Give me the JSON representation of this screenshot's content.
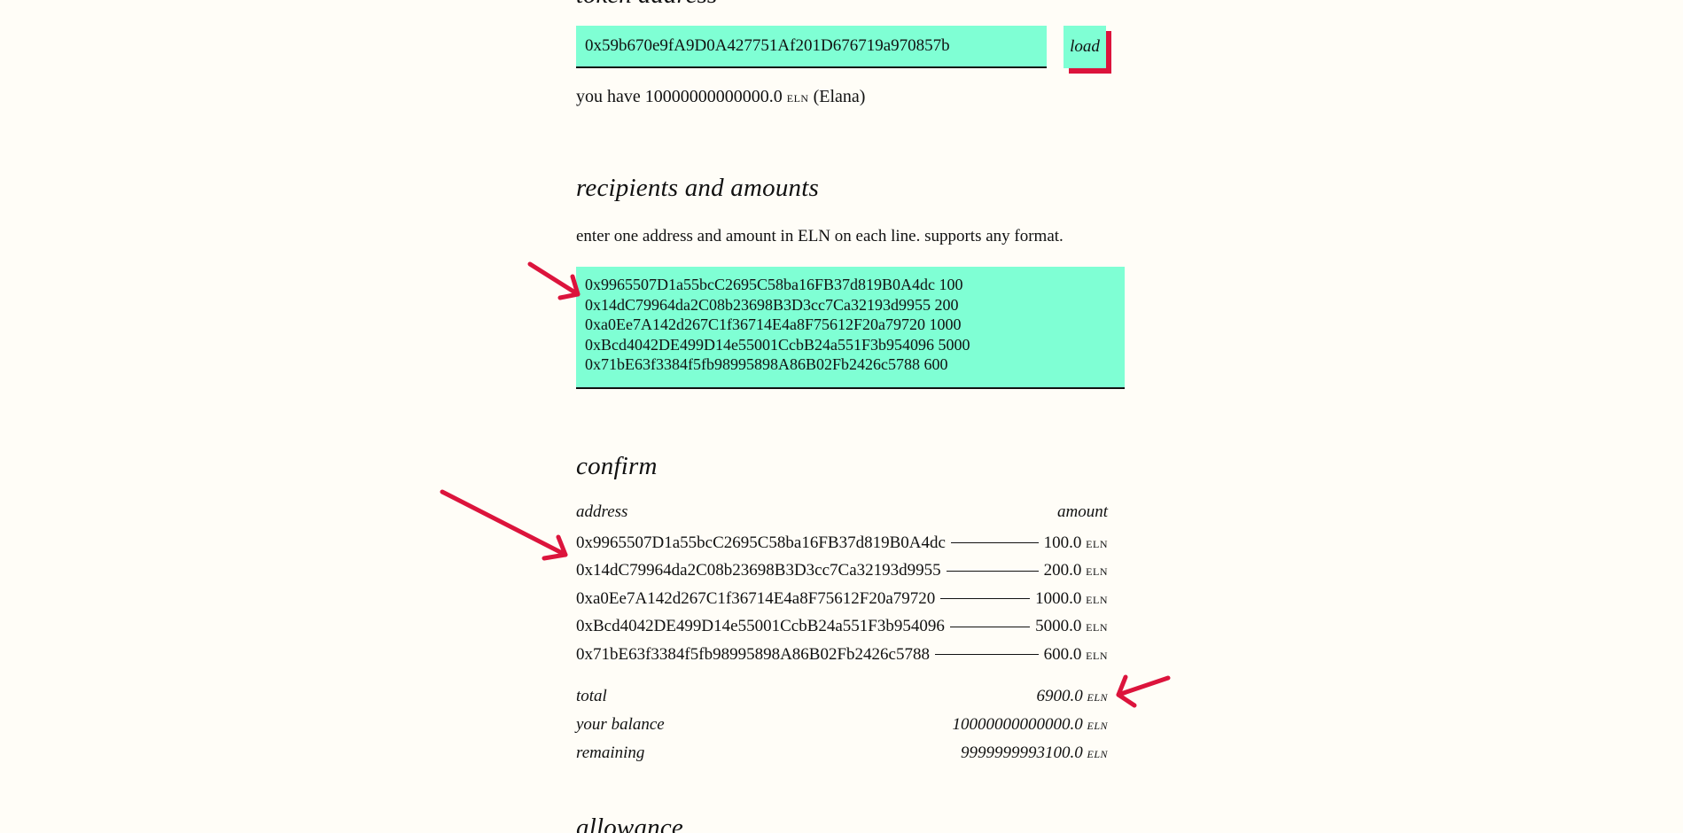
{
  "token": {
    "heading": "token address",
    "address_value": "0x59b670e9fA9D0A427751Af201D676719a970857b",
    "load_label": "load",
    "balance_prefix": "you have 10000000000000.0",
    "balance_unit": "eln",
    "balance_name": "(Elana)"
  },
  "recipients": {
    "heading": "recipients and amounts",
    "help": "enter one address and amount in ELN on each line. supports any format.",
    "textarea_value": "0x9965507D1a55bcC2695C58ba16FB37d819B0A4dc 100\n0x14dC79964da2C08b23698B3D3cc7Ca32193d9955 200\n0xa0Ee7A142d267C1f36714E4a8F75612F20a79720 1000\n0xBcd4042DE499D14e55001CcbB24a551F3b954096 5000\n0x71bE63f3384f5fb98995898A86B02Fb2426c5788 600"
  },
  "confirm": {
    "heading": "confirm",
    "col_address": "address",
    "col_amount": "amount",
    "unit": "eln",
    "rows": [
      {
        "address": "0x9965507D1a55bcC2695C58ba16FB37d819B0A4dc",
        "amount": "100.0"
      },
      {
        "address": "0x14dC79964da2C08b23698B3D3cc7Ca32193d9955",
        "amount": "200.0"
      },
      {
        "address": "0xa0Ee7A142d267C1f36714E4a8F75612F20a79720",
        "amount": "1000.0"
      },
      {
        "address": "0xBcd4042DE499D14e55001CcbB24a551F3b954096",
        "amount": "5000.0"
      },
      {
        "address": "0x71bE63f3384f5fb98995898A86B02Fb2426c5788",
        "amount": "600.0"
      }
    ],
    "total_label": "total",
    "total_value": "6900.0",
    "balance_label": "your balance",
    "balance_value": "10000000000000.0",
    "remaining_label": "remaining",
    "remaining_value": "9999999993100.0"
  },
  "allowance": {
    "heading": "allowance"
  },
  "colors": {
    "background": "#fffdf7",
    "input_fill": "#7fffd4",
    "accent": "#dc143c",
    "text": "#111111"
  }
}
